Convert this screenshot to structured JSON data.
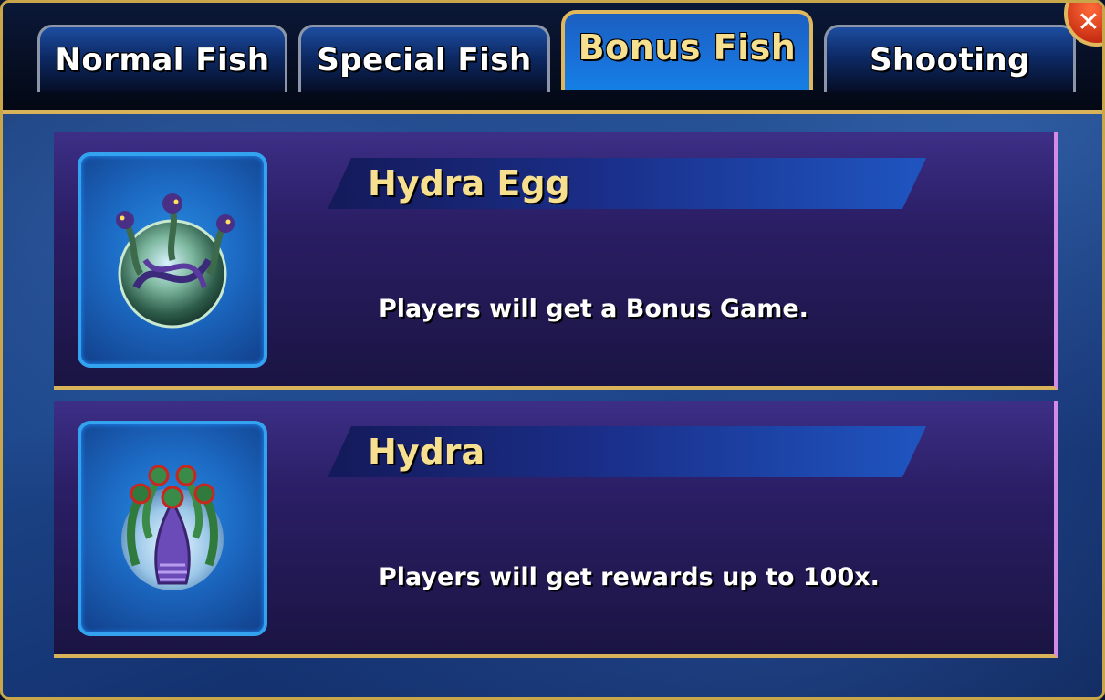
{
  "tabs": [
    {
      "label": "Normal Fish",
      "active": false
    },
    {
      "label": "Special Fish",
      "active": false
    },
    {
      "label": "Bonus Fish",
      "active": true
    },
    {
      "label": "Shooting",
      "active": false
    }
  ],
  "close_button": {
    "icon": "close-icon"
  },
  "fish": [
    {
      "name": "Hydra Egg",
      "description": "Players will get a Bonus Game.",
      "icon": "hydra-egg-icon"
    },
    {
      "name": "Hydra",
      "description": "Players will get rewards up to 100x.",
      "icon": "hydra-icon"
    }
  ],
  "colors": {
    "gold": "#d9b35a",
    "title_text": "#f6df8e",
    "thumb_border": "#33a3f0",
    "card_bg": "#2b1e66"
  }
}
